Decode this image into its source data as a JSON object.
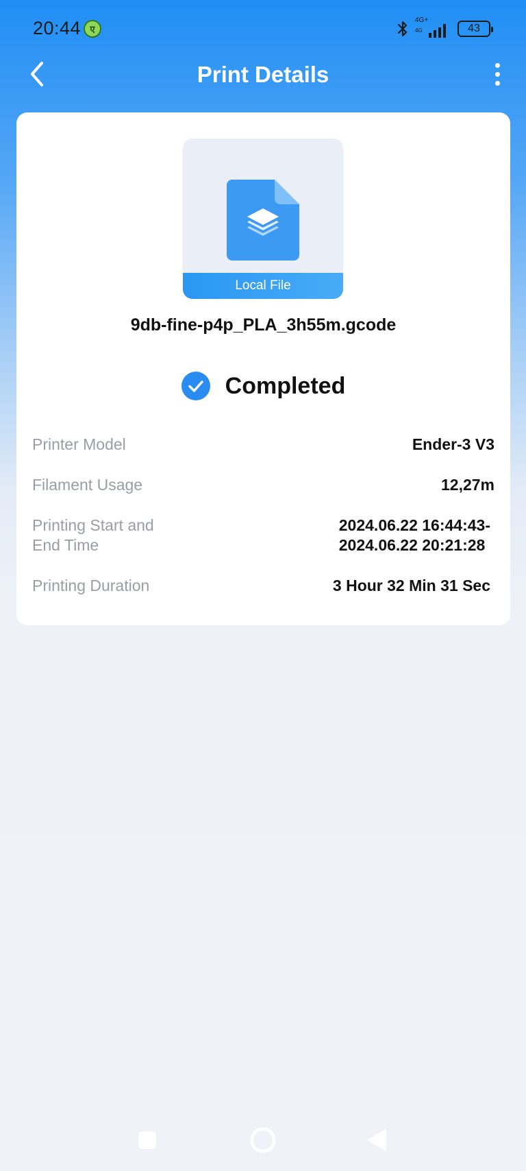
{
  "status_bar": {
    "time": "20:44",
    "app_badge": "ए",
    "network_label": "4G+",
    "network_sub": "4G",
    "battery": "43"
  },
  "header": {
    "title": "Print Details"
  },
  "file": {
    "badge": "Local File",
    "name": "9db-fine-p4p_PLA_3h55m.gcode"
  },
  "status": {
    "text": "Completed",
    "color": "#2a8cf0"
  },
  "details": {
    "printer_model": {
      "label": "Printer Model",
      "value": "Ender-3 V3"
    },
    "filament_usage": {
      "label": "Filament Usage",
      "value": "12,27m"
    },
    "time_range": {
      "label_line1": "Printing Start and",
      "label_line2": "End Time",
      "value_line1": "2024.06.22 16:44:43-",
      "value_line2": "2024.06.22 20:21:28"
    },
    "duration": {
      "label": "Printing Duration",
      "value": "3 Hour 32 Min 31 Sec"
    }
  },
  "colors": {
    "accent": "#2a8cf0",
    "file_icon": "#3d9af3",
    "card": "#ffffff"
  }
}
